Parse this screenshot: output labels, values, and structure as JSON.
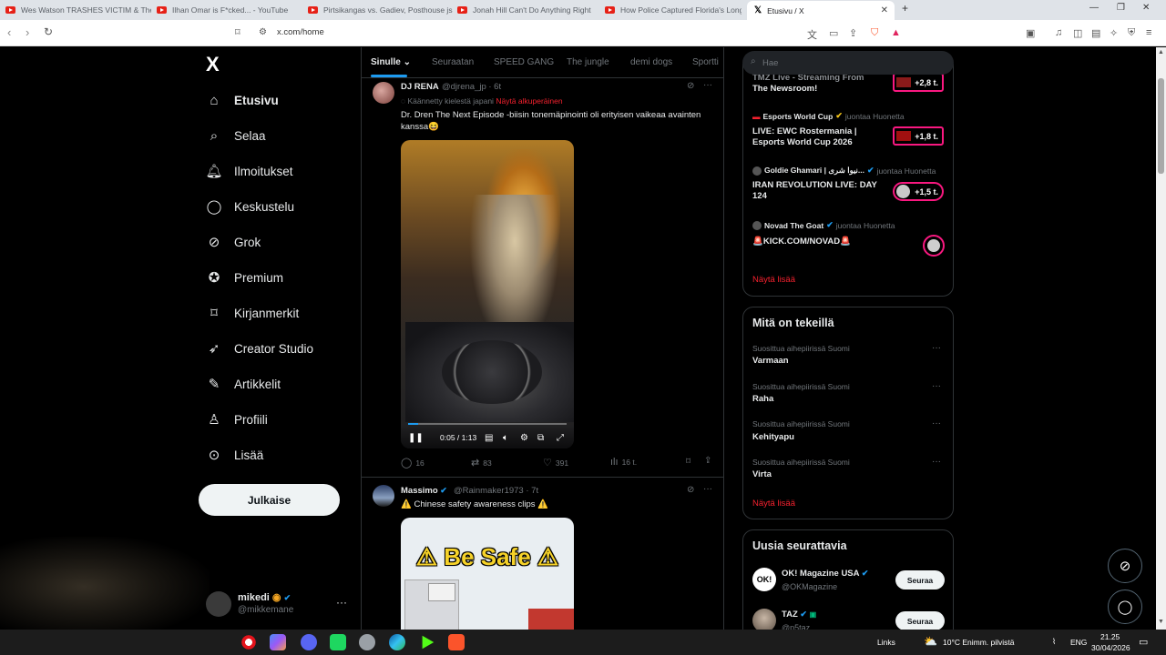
{
  "browser": {
    "tabs": [
      {
        "title": "Wes Watson TRASHES VICTIM & The"
      },
      {
        "title": "Ilhan Omar is F*cked... - YouTube"
      },
      {
        "title": "Pirtsikangas vs. Gadiev, Posthouse js"
      },
      {
        "title": "Jonah Hill Can't Do Anything Right"
      },
      {
        "title": "How Police Captured Florida's Longe"
      },
      {
        "title": "Etusivu / X"
      }
    ],
    "url": "x.com/home"
  },
  "sidebar": {
    "logo": "X",
    "items": [
      {
        "label": "Etusivu",
        "icon": "home-icon"
      },
      {
        "label": "Selaa",
        "icon": "search-icon"
      },
      {
        "label": "Ilmoitukset",
        "icon": "bell-icon"
      },
      {
        "label": "Keskustelu",
        "icon": "chat-icon"
      },
      {
        "label": "Grok",
        "icon": "grok-icon"
      },
      {
        "label": "Premium",
        "icon": "premium-icon"
      },
      {
        "label": "Kirjanmerkit",
        "icon": "bookmark-icon"
      },
      {
        "label": "Creator Studio",
        "icon": "rocket-icon"
      },
      {
        "label": "Artikkelit",
        "icon": "article-icon"
      },
      {
        "label": "Profiili",
        "icon": "person-icon"
      },
      {
        "label": "Lisää",
        "icon": "more-icon"
      }
    ],
    "post_button": "Julkaise",
    "account": {
      "name": "mikedi",
      "handle": "@mikkemane"
    }
  },
  "feed": {
    "tabs": [
      "Sinulle",
      "Seuraatan",
      "SPEED GANG",
      "The jungle",
      "demi dogs",
      "Sportti"
    ],
    "tweets": [
      {
        "name": "DJ RENA",
        "handle": "@djrena_jp",
        "time": "· 6t",
        "translated": "Käännetty kielestä japani",
        "show_original": "Näytä alkuperäinen",
        "text": "Dr. Dren The Next Episode -biisin tonemäpinointi oli erityisen vaikeaa avainten kanssa😆",
        "video": {
          "time": "0:05 / 1:13",
          "progress": 0.066
        },
        "stats": {
          "replies": "16",
          "retweets": "83",
          "likes": "391",
          "views": "16 t."
        }
      },
      {
        "name": "Massimo",
        "handle": "@Rainmaker1973",
        "time": "· 7t",
        "text": "⚠️ Chinese safety awareness clips ⚠️",
        "video_title": "⚠ Be Safe ⚠"
      }
    ]
  },
  "right": {
    "search_placeholder": "Hae",
    "live": [
      {
        "host": "",
        "host_sub": "",
        "title": "The Newsroom!",
        "title_top": "TMZ Live - Streaming From",
        "count": "+2,8 t."
      },
      {
        "host": "Esports World Cup",
        "host_sub": "juontaa Huonetta",
        "title": "LIVE: EWC Rostermania | Esports World Cup 2026",
        "count": "+1,8 t."
      },
      {
        "host": "Goldie Ghamari | نیوا شری...",
        "host_sub": "juontaa Huonetta",
        "title": "IRAN REVOLUTION LIVE: DAY 124",
        "count": "+1,5 t."
      },
      {
        "host": "Novad The Goat",
        "host_sub": "juontaa Huonetta",
        "title": "🚨KICK.COM/NOVAD🚨",
        "count": ""
      }
    ],
    "live_show_more": "Näytä lisää",
    "trends_title": "Mitä on tekeillä",
    "trends": [
      {
        "context": "Suosittua aihepiirissä Suomi",
        "name": "Varmaan"
      },
      {
        "context": "Suosittua aihepiirissä Suomi",
        "name": "Raha"
      },
      {
        "context": "Suosittua aihepiirissä Suomi",
        "name": "Kehityapu"
      },
      {
        "context": "Suosittua aihepiirissä Suomi",
        "name": "Virta"
      }
    ],
    "trends_show_more": "Näytä lisää",
    "follow_title": "Uusia seurattavia",
    "follow": [
      {
        "name": "OK! Magazine USA",
        "handle": "@OKMagazine",
        "button": "Seuraa"
      },
      {
        "name": "TAZ",
        "handle": "@p5taz",
        "button": "Seuraa"
      }
    ]
  },
  "taskbar": {
    "links": "Links",
    "weather": "10°C  Enimm. pilvistä",
    "lang": "ENG",
    "time": "21.25",
    "date": "30/04/2026"
  },
  "colors": {
    "accent": "#1d9bf0",
    "link_red": "#f4212e",
    "live_pink": "#f91880"
  }
}
